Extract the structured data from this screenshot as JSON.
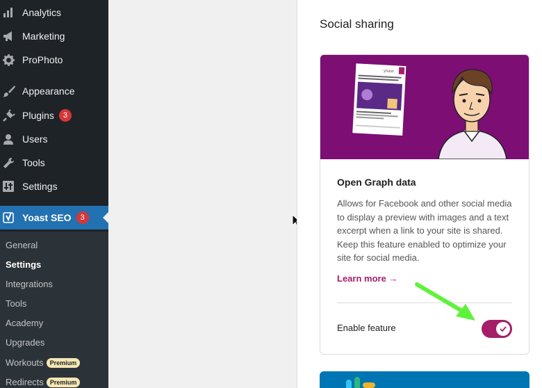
{
  "sidebar": {
    "items": [
      {
        "label": "Analytics",
        "icon": "bar-chart-icon"
      },
      {
        "label": "Marketing",
        "icon": "megaphone-icon"
      },
      {
        "label": "ProPhoto",
        "icon": "gear-icon"
      },
      {
        "label": "Appearance",
        "icon": "paintbrush-icon"
      },
      {
        "label": "Plugins",
        "icon": "plug-icon",
        "badge": "3"
      },
      {
        "label": "Users",
        "icon": "user-icon"
      },
      {
        "label": "Tools",
        "icon": "wrench-icon"
      },
      {
        "label": "Settings",
        "icon": "sliders-icon"
      },
      {
        "label": "Yoast SEO",
        "icon": "yoast-icon",
        "badge": "3"
      }
    ],
    "submenu": [
      {
        "label": "General"
      },
      {
        "label": "Settings"
      },
      {
        "label": "Integrations"
      },
      {
        "label": "Tools"
      },
      {
        "label": "Academy"
      },
      {
        "label": "Upgrades"
      },
      {
        "label": "Workouts",
        "badge": "Premium"
      },
      {
        "label": "Redirects",
        "badge": "Premium"
      }
    ]
  },
  "main": {
    "section_title": "Social sharing",
    "card": {
      "title": "Open Graph data",
      "description": "Allows for Facebook and other social media to display a preview with images and a text excerpt when a link to your site is shared. Keep this feature enabled to optimize your site for social media.",
      "learn_more": "Learn more →",
      "toggle_label": "Enable feature",
      "toggle_on": true
    }
  },
  "colors": {
    "sidebar_bg": "#1d2327",
    "active_bg": "#2271b1",
    "yoast_primary": "#a61e69",
    "card_image_bg": "#7c0e74",
    "arrow": "#5ff23a"
  }
}
